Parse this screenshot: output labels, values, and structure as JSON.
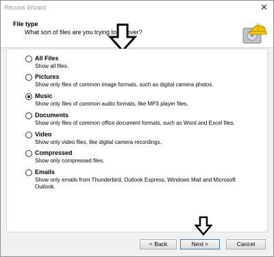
{
  "window": {
    "title": "Recuva Wizard",
    "close_glyph": "✕"
  },
  "header": {
    "title": "File type",
    "subtitle": "What sort of files are you trying to recover?",
    "logo_icon": "recuva-hardhat-drive-icon"
  },
  "options": [
    {
      "label": "All Files",
      "description": "Show all files.",
      "checked": false
    },
    {
      "label": "Pictures",
      "description": "Show only files of common image formats, such as digital camera photos.",
      "checked": false
    },
    {
      "label": "Music",
      "description": "Show only files of common audio formats, like MP3 player files.",
      "checked": true
    },
    {
      "label": "Documents",
      "description": "Show only files of common office document formats, such as Word and Excel files.",
      "checked": false
    },
    {
      "label": "Video",
      "description": "Show only video files, like digital camera recordings.",
      "checked": false
    },
    {
      "label": "Compressed",
      "description": "Show only compressed files.",
      "checked": false
    },
    {
      "label": "Emails",
      "description": "Show only emails from Thunderbird, Outlook Express, Windows Mail and Microsoft Outlook.",
      "checked": false
    }
  ],
  "buttons": {
    "back": "< Back",
    "next": "Next >",
    "cancel": "Cancel"
  },
  "annotations": {
    "arrow_icon": "down-arrow-icon"
  }
}
